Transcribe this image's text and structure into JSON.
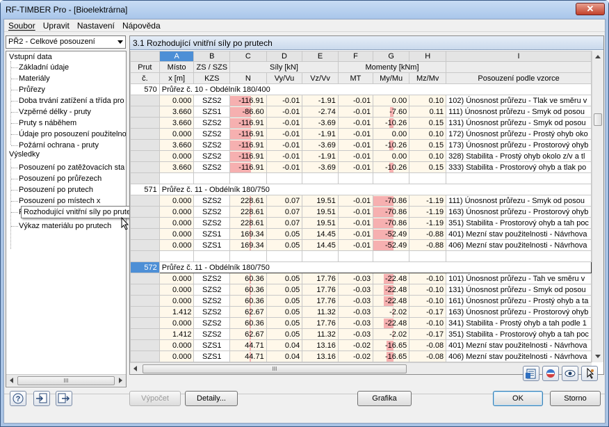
{
  "window": {
    "title": "RF-TIMBER Pro - [Bioelektrárna]",
    "close": "✕"
  },
  "menu": [
    "Soubor",
    "Upravit",
    "Nastavení",
    "Nápověda"
  ],
  "case_combo": "PŘ2 - Celkové posouzení",
  "tree": {
    "input_group": "Vstupní data",
    "input_items": [
      "Základní údaje",
      "Materiály",
      "Průřezy",
      "Doba trvání zatížení a třída pro",
      "Vzpěrné délky - pruty",
      "Pruty s náběhem",
      "Údaje pro posouzení použitelno",
      "Požární ochrana - pruty"
    ],
    "results_group": "Výsledky",
    "results_items": [
      "Posouzení po zatěžovacích sta",
      "Posouzení po průřezech",
      "Posouzení po prutech",
      "Posouzení po místech x",
      "Rozhodující vnitřní síly po prutech",
      "Výkaz materiálu po prutech"
    ],
    "scroll_label": "III"
  },
  "tooltip": "Rozhodující vnitřní síly po prutech",
  "panel_title": "3.1 Rozhodující vnitřní síly po prutech",
  "grid": {
    "columns": [
      "A",
      "B",
      "C",
      "D",
      "E",
      "F",
      "G",
      "H",
      "I"
    ],
    "header_row1": {
      "prut": "Prut",
      "misto": "Místo",
      "zs": "ZS / SZS",
      "sily": "Síly [kN]",
      "momenty": "Momenty [kNm]"
    },
    "header_row2": {
      "prut": "č.",
      "misto": "x [m]",
      "zs": "KZS",
      "n": "N",
      "vy": "Vy/Vu",
      "vz": "Vz/Vv",
      "mt": "MT",
      "my": "My/Mu",
      "mz": "Mz/Mv",
      "pos": "Posouzení podle vzorce"
    },
    "groups": [
      {
        "member": "570",
        "section": "Průřez č.  10 - Obdélník 180/400",
        "selected": false,
        "rows": [
          [
            "0.000",
            "SZS2",
            "-116.91",
            "-0.01",
            "-1.91",
            "-0.01",
            "0.00",
            "0.10",
            "102) Únosnost průřezu - Tlak ve směru v"
          ],
          [
            "3.660",
            "SZS1",
            "-86.60",
            "-0.01",
            "-2.74",
            "-0.01",
            "-7.60",
            "0.11",
            "111) Únosnost průřezu - Smyk od posou"
          ],
          [
            "3.660",
            "SZS2",
            "-116.91",
            "-0.01",
            "-3.69",
            "-0.01",
            "-10.26",
            "0.15",
            "131) Únosnost průřezu - Smyk od posou"
          ],
          [
            "0.000",
            "SZS2",
            "-116.91",
            "-0.01",
            "-1.91",
            "-0.01",
            "0.00",
            "0.10",
            "172) Únosnost průřezu - Prostý ohyb oko"
          ],
          [
            "3.660",
            "SZS2",
            "-116.91",
            "-0.01",
            "-3.69",
            "-0.01",
            "-10.26",
            "0.15",
            "173) Únosnost průřezu - Prostorový ohyb"
          ],
          [
            "0.000",
            "SZS2",
            "-116.91",
            "-0.01",
            "-1.91",
            "-0.01",
            "0.00",
            "0.10",
            "328) Stabilita - Prostý ohyb okolo z/v a tl"
          ],
          [
            "3.660",
            "SZS2",
            "-116.91",
            "-0.01",
            "-3.69",
            "-0.01",
            "-10.26",
            "0.15",
            "333) Stabilita - Prostorový ohyb a tlak po"
          ]
        ]
      },
      {
        "member": "571",
        "section": "Průřez č.  11 - Obdélník 180/750",
        "selected": false,
        "rows": [
          [
            "0.000",
            "SZS2",
            "228.61",
            "0.07",
            "19.51",
            "-0.01",
            "-70.86",
            "-1.19",
            "111) Únosnost průřezu - Smyk od posou"
          ],
          [
            "0.000",
            "SZS2",
            "228.61",
            "0.07",
            "19.51",
            "-0.01",
            "-70.86",
            "-1.19",
            "163) Únosnost průřezu - Prostorový ohyb"
          ],
          [
            "0.000",
            "SZS2",
            "228.61",
            "0.07",
            "19.51",
            "-0.01",
            "-70.86",
            "-1.19",
            "351) Stabilita - Prostorový ohyb a tah poc"
          ],
          [
            "0.000",
            "SZS1",
            "169.34",
            "0.05",
            "14.45",
            "-0.01",
            "-52.49",
            "-0.88",
            "401) Mezní stav použitelnosti - Návrhova"
          ],
          [
            "0.000",
            "SZS1",
            "169.34",
            "0.05",
            "14.45",
            "-0.01",
            "-52.49",
            "-0.88",
            "406) Mezní stav použitelnosti - Návrhova"
          ]
        ]
      },
      {
        "member": "572",
        "section": "Průřez č.  11 - Obdélník 180/750",
        "selected": true,
        "rows": [
          [
            "0.000",
            "SZS2",
            "60.36",
            "0.05",
            "17.76",
            "-0.03",
            "-22.48",
            "-0.10",
            "101) Únosnost průřezu - Tah ve směru v"
          ],
          [
            "0.000",
            "SZS2",
            "60.36",
            "0.05",
            "17.76",
            "-0.03",
            "-22.48",
            "-0.10",
            "131) Únosnost průřezu - Smyk od posou"
          ],
          [
            "0.000",
            "SZS2",
            "60.36",
            "0.05",
            "17.76",
            "-0.03",
            "-22.48",
            "-0.10",
            "161) Únosnost průřezu - Prostý ohyb a ta"
          ],
          [
            "1.412",
            "SZS2",
            "62.67",
            "0.05",
            "11.32",
            "-0.03",
            "-2.02",
            "-0.17",
            "163) Únosnost průřezu - Prostorový ohyb"
          ],
          [
            "0.000",
            "SZS2",
            "60.36",
            "0.05",
            "17.76",
            "-0.03",
            "-22.48",
            "-0.10",
            "341) Stabilita - Prostý ohyb a tah podle 1"
          ],
          [
            "1.412",
            "SZS2",
            "62.67",
            "0.05",
            "11.32",
            "-0.03",
            "-2.02",
            "-0.17",
            "351) Stabilita - Prostorový ohyb a tah poc"
          ],
          [
            "0.000",
            "SZS1",
            "44.71",
            "0.04",
            "13.16",
            "-0.02",
            "-16.65",
            "-0.08",
            "401) Mezní stav použitelnosti - Návrhova"
          ],
          [
            "0.000",
            "SZS1",
            "44.71",
            "0.04",
            "13.16",
            "-0.02",
            "-16.65",
            "-0.08",
            "406) Mezní stav použitelnosti - Návrhova"
          ]
        ]
      }
    ],
    "scroll_label": "III"
  },
  "buttons": {
    "vypocet": "Výpočet",
    "detaily": "Detaily...",
    "grafika": "Grafika",
    "ok": "OK",
    "storno": "Storno"
  },
  "icons": [
    "help-icon",
    "import-icon",
    "export-icon",
    "excel-icon",
    "color-scale-icon",
    "view-icon",
    "pointer-icon"
  ],
  "colors": {
    "selection": "#4d8fd6",
    "negative_bar": "#f6b0b0",
    "cell_bg": "#fff8ea",
    "title_bar": "#a9c6ea"
  }
}
